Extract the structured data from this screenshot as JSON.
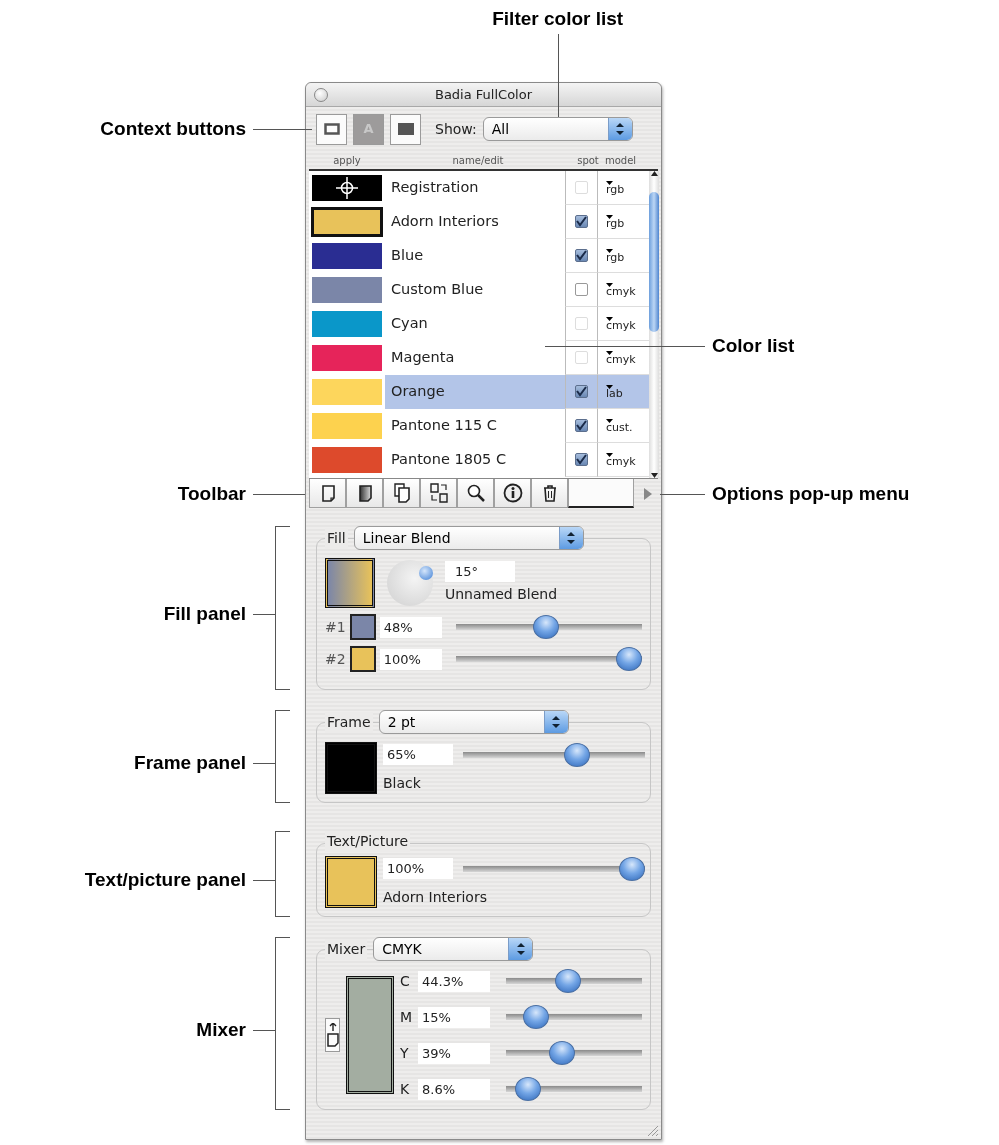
{
  "annotations": [
    {
      "kind": "top",
      "text": "Filter color list"
    },
    {
      "kind": "left",
      "text": "Context buttons"
    },
    {
      "kind": "left",
      "text": "Toolbar"
    },
    {
      "kind": "left",
      "text": "Fill panel"
    },
    {
      "kind": "left",
      "text": "Frame panel"
    },
    {
      "kind": "left",
      "text": "Text/picture panel"
    },
    {
      "kind": "left",
      "text": "Mixer"
    },
    {
      "kind": "right",
      "text": "Color list"
    },
    {
      "kind": "right",
      "text": "Options pop-up menu"
    }
  ],
  "window": {
    "title": "Badia FullColor"
  },
  "context_buttons": [
    {
      "kind": "frame",
      "selected": false
    },
    {
      "kind": "text",
      "label": "A",
      "selected": true
    },
    {
      "kind": "fill",
      "selected": false
    }
  ],
  "show": {
    "label": "Show:",
    "value": "All"
  },
  "columns": [
    "apply",
    "name/edit",
    "spot",
    "model"
  ],
  "colors": [
    {
      "kind": "registration",
      "name": "Registration",
      "color": "#000000",
      "current": false,
      "selected": false,
      "spot_checked": false,
      "spot_disabled": true,
      "model": "rgb"
    },
    {
      "kind": "color",
      "name": "Adorn Interiors",
      "color": "#e8c25a",
      "current": true,
      "selected": false,
      "spot_checked": true,
      "spot_disabled": false,
      "model": "rgb"
    },
    {
      "kind": "color",
      "name": "Blue",
      "color": "#2a2d92",
      "current": false,
      "selected": false,
      "spot_checked": true,
      "spot_disabled": false,
      "model": "rgb"
    },
    {
      "kind": "color",
      "name": "Custom Blue",
      "color": "#7b86a8",
      "current": false,
      "selected": false,
      "spot_checked": false,
      "spot_disabled": false,
      "model": "cmyk"
    },
    {
      "kind": "color",
      "name": "Cyan",
      "color": "#0a97c9",
      "current": false,
      "selected": false,
      "spot_checked": false,
      "spot_disabled": true,
      "model": "cmyk"
    },
    {
      "kind": "color",
      "name": "Magenta",
      "color": "#e6245a",
      "current": false,
      "selected": false,
      "spot_checked": false,
      "spot_disabled": true,
      "model": "cmyk"
    },
    {
      "kind": "color",
      "name": "Orange",
      "color": "#fdd65c",
      "current": false,
      "selected": true,
      "spot_checked": true,
      "spot_disabled": false,
      "model": "lab"
    },
    {
      "kind": "color",
      "name": "Pantone 115 C",
      "color": "#fdd24e",
      "current": false,
      "selected": false,
      "spot_checked": true,
      "spot_disabled": false,
      "model": "cust."
    },
    {
      "kind": "color",
      "name": "Pantone 1805 C",
      "color": "#dd4a2c",
      "current": false,
      "selected": false,
      "spot_checked": true,
      "spot_disabled": false,
      "model": "cmyk"
    }
  ],
  "fill": {
    "label": "Fill",
    "type": "Linear Blend",
    "angle": "15°",
    "blend_name": "Unnamed Blend",
    "stops": [
      {
        "label": "#1",
        "color": "#7b86a8",
        "value": "48%",
        "level": 0.48
      },
      {
        "label": "#2",
        "color": "#e8c25a",
        "value": "100%",
        "level": 1.0
      }
    ]
  },
  "frame": {
    "label": "Frame",
    "type": "2 pt",
    "color": "#000000",
    "value": "65%",
    "level": 0.65,
    "color_name": "Black"
  },
  "text_picture": {
    "label": "Text/Picture",
    "color": "#e8c25a",
    "value": "100%",
    "level": 1.0,
    "color_name": "Adorn Interiors"
  },
  "mixer": {
    "label": "Mixer",
    "model": "CMYK",
    "color": "#a3ada1",
    "channels": [
      {
        "label": "C",
        "value": "44.3%",
        "level": 0.443
      },
      {
        "label": "M",
        "value": "15%",
        "level": 0.15
      },
      {
        "label": "Y",
        "value": "39%",
        "level": 0.39
      },
      {
        "label": "K",
        "value": "8.6%",
        "level": 0.086
      }
    ]
  }
}
